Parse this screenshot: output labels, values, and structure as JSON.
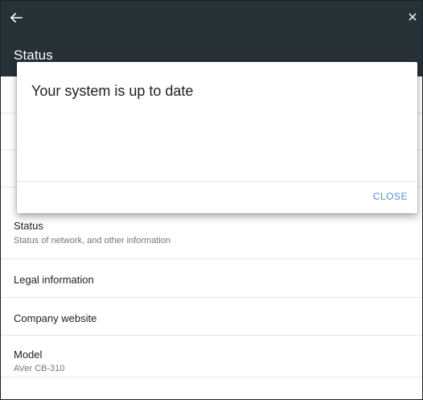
{
  "appbar": {
    "title": "Status",
    "background": "#263238"
  },
  "list": {
    "items": [
      {
        "title": "Status",
        "subtitle": "Status of network, and other information"
      },
      {
        "title": "Legal information"
      },
      {
        "title": "Company website"
      },
      {
        "title": "Model",
        "subtitle": "AVer CB-310"
      }
    ]
  },
  "dialog": {
    "message": "Your system is up to date",
    "close_label": "CLOSE",
    "accent": "#4a90d9"
  },
  "icons": {
    "back": "arrow-back-icon",
    "close": "close-icon"
  }
}
